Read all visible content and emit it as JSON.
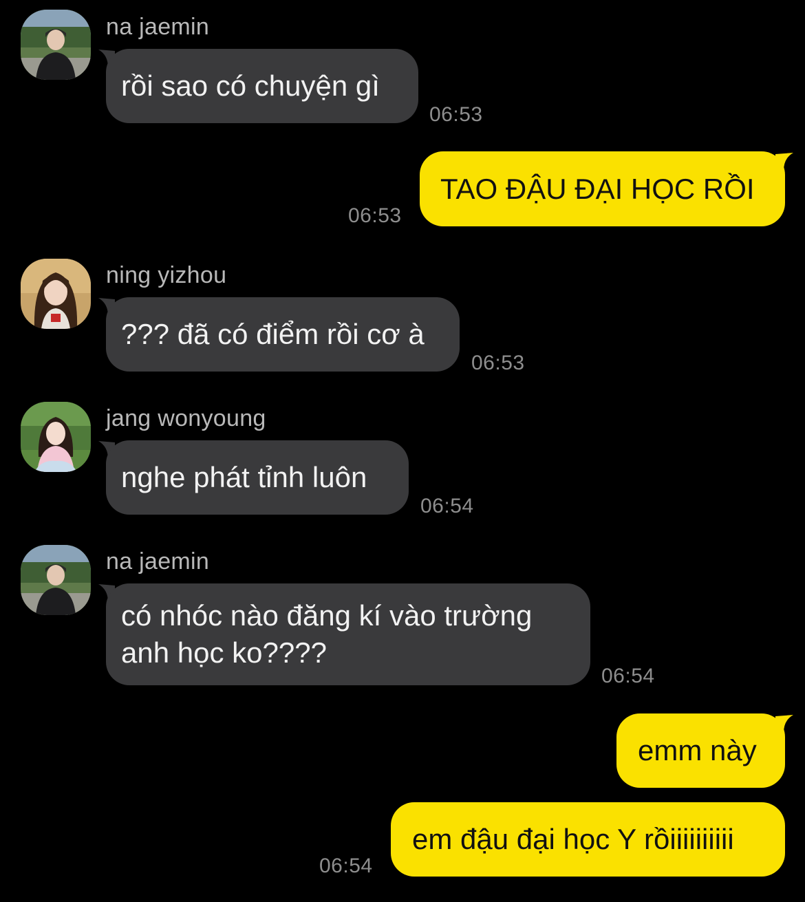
{
  "chat": {
    "messages": [
      {
        "sender": "na jaemin",
        "text": "rồi sao có chuyện gì",
        "time": "06:53"
      },
      {
        "text": "TAO ĐẬU ĐẠI HỌC RỒI",
        "time": "06:53"
      },
      {
        "sender": "ning yizhou",
        "text": "??? đã có điểm rồi cơ à",
        "time": "06:53"
      },
      {
        "sender": "jang wonyoung",
        "text": "nghe phát tỉnh luôn",
        "time": "06:54"
      },
      {
        "sender": "na jaemin",
        "text": "có nhóc nào đăng kí vào trường anh học ko????",
        "time": "06:54"
      },
      {
        "text": "emm này"
      },
      {
        "text": "em đậu đại học Y rồiiiiiiiiii",
        "time": "06:54"
      }
    ]
  },
  "colors": {
    "background": "#000000",
    "incoming_bubble": "#3a3a3c",
    "outgoing_bubble": "#fae100",
    "timestamp": "#8e8e8e",
    "sender_name": "#b9b9b9"
  },
  "icons": {
    "avatar_jaemin": "avatar-photo",
    "avatar_yizhou": "avatar-photo",
    "avatar_wonyoung": "avatar-photo"
  }
}
